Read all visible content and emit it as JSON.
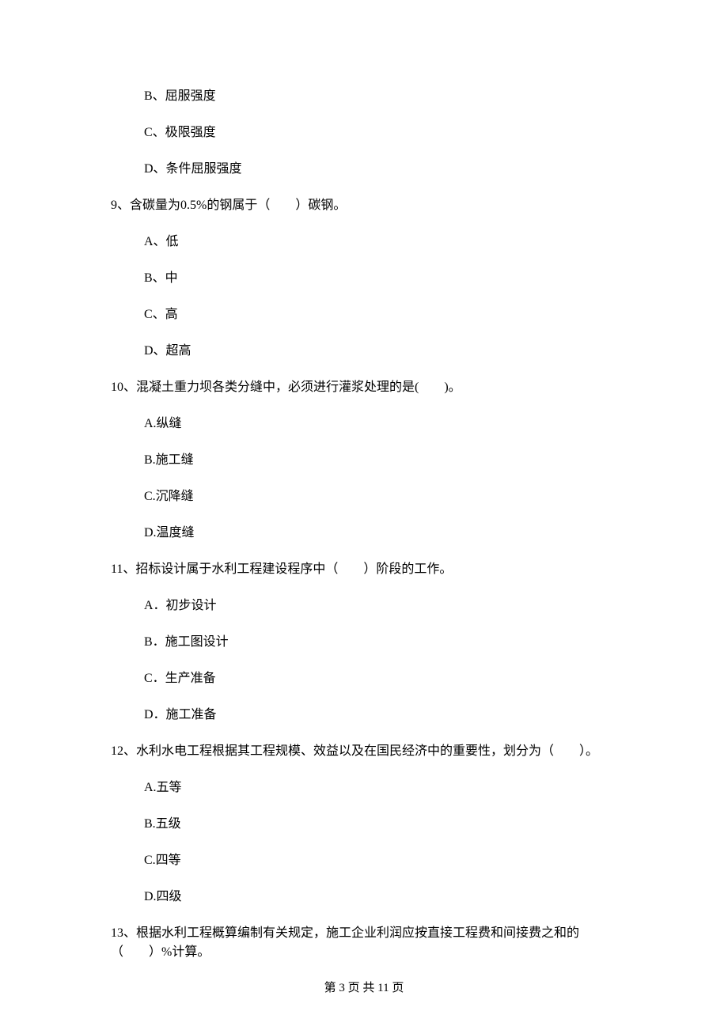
{
  "orphan_options": [
    "B、屈服强度",
    "C、极限强度",
    "D、条件屈服强度"
  ],
  "questions": [
    {
      "stem": "9、含碳量为0.5%的钢属于（　　）碳钢。",
      "options": [
        "A、低",
        "B、中",
        "C、高",
        "D、超高"
      ]
    },
    {
      "stem": "10、混凝土重力坝各类分缝中，必须进行灌浆处理的是(　　)。",
      "options": [
        "A.纵缝",
        "B.施工缝",
        "C.沉降缝",
        "D.温度缝"
      ]
    },
    {
      "stem": "11、招标设计属于水利工程建设程序中（　　）阶段的工作。",
      "options": [
        "A．初步设计",
        "B．施工图设计",
        "C．生产准备",
        "D．施工准备"
      ]
    },
    {
      "stem": "12、水利水电工程根据其工程规模、效益以及在国民经济中的重要性，划分为（　　）。",
      "options": [
        "A.五等",
        "B.五级",
        "C.四等",
        "D.四级"
      ]
    },
    {
      "stem": "13、根据水利工程概算编制有关规定，施工企业利润应按直接工程费和间接费之和的（　　）%计算。",
      "options": []
    }
  ],
  "footer": "第 3 页 共 11 页"
}
